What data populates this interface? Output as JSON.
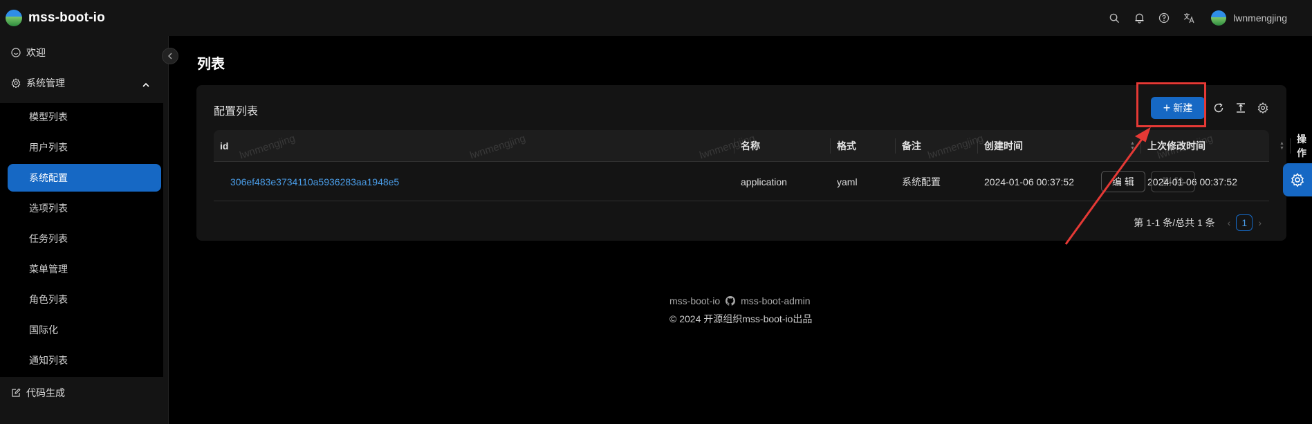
{
  "header": {
    "app_title": "mss-boot-io",
    "username": "lwnmengjing"
  },
  "sidebar": {
    "items": [
      {
        "label": "欢迎",
        "icon": "smile-icon"
      },
      {
        "label": "系统管理",
        "icon": "gear-icon"
      },
      {
        "label": "代码生成",
        "icon": "edit-icon"
      }
    ],
    "sub_items": [
      "模型列表",
      "用户列表",
      "系统配置",
      "选项列表",
      "任务列表",
      "菜单管理",
      "角色列表",
      "国际化",
      "通知列表"
    ],
    "active": "系统配置"
  },
  "page": {
    "title": "列表"
  },
  "card": {
    "title": "配置列表",
    "new_label": "新建"
  },
  "table": {
    "columns": [
      "id",
      "名称",
      "格式",
      "备注",
      "创建时间",
      "上次修改时间",
      "操作"
    ],
    "rows": [
      {
        "id": "306ef483e3734110a5936283aa1948e5",
        "name": "application",
        "format": "yaml",
        "remark": "系统配置",
        "created": "2024-01-06 00:37:52",
        "updated": "2024-01-06 00:37:52",
        "edit": "编 辑",
        "delete": "删 除"
      }
    ]
  },
  "pagination": {
    "summary": "第 1-1 条/总共 1 条",
    "current": "1"
  },
  "footer": {
    "link1": "mss-boot-io",
    "link2": "mss-boot-admin",
    "copyright": "2024 开源组织mss-boot-io出品"
  },
  "watermark": "lwnmengjing",
  "colors": {
    "primary": "#1668c4",
    "link": "#4a9de8",
    "annotation": "#e53935"
  }
}
